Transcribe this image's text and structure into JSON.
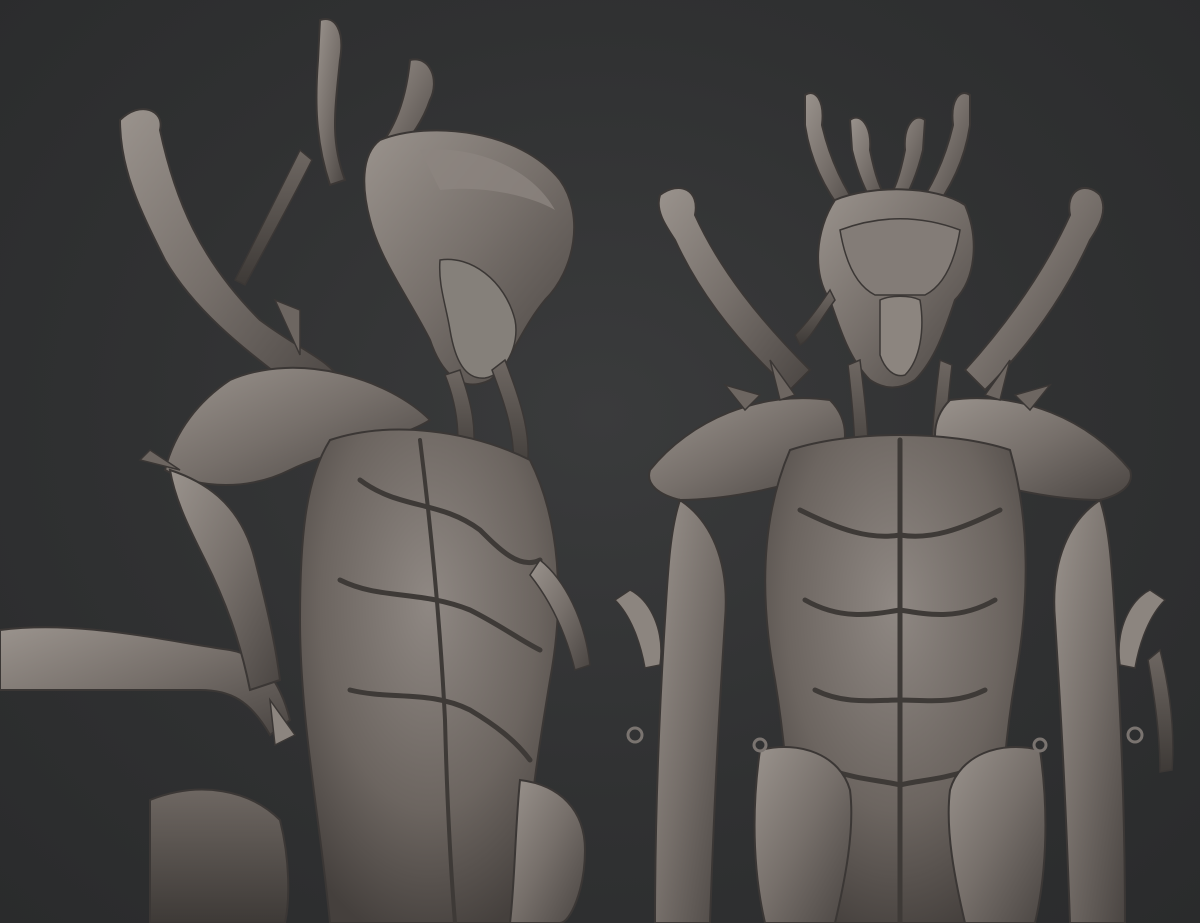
{
  "scene": {
    "background_color": "#2f3031",
    "clay_color": "#7a7470",
    "shadow_color": "#3d3937",
    "highlight_color": "#a59e98"
  },
  "figures": [
    {
      "view": "three-quarter"
    },
    {
      "view": "front"
    }
  ]
}
